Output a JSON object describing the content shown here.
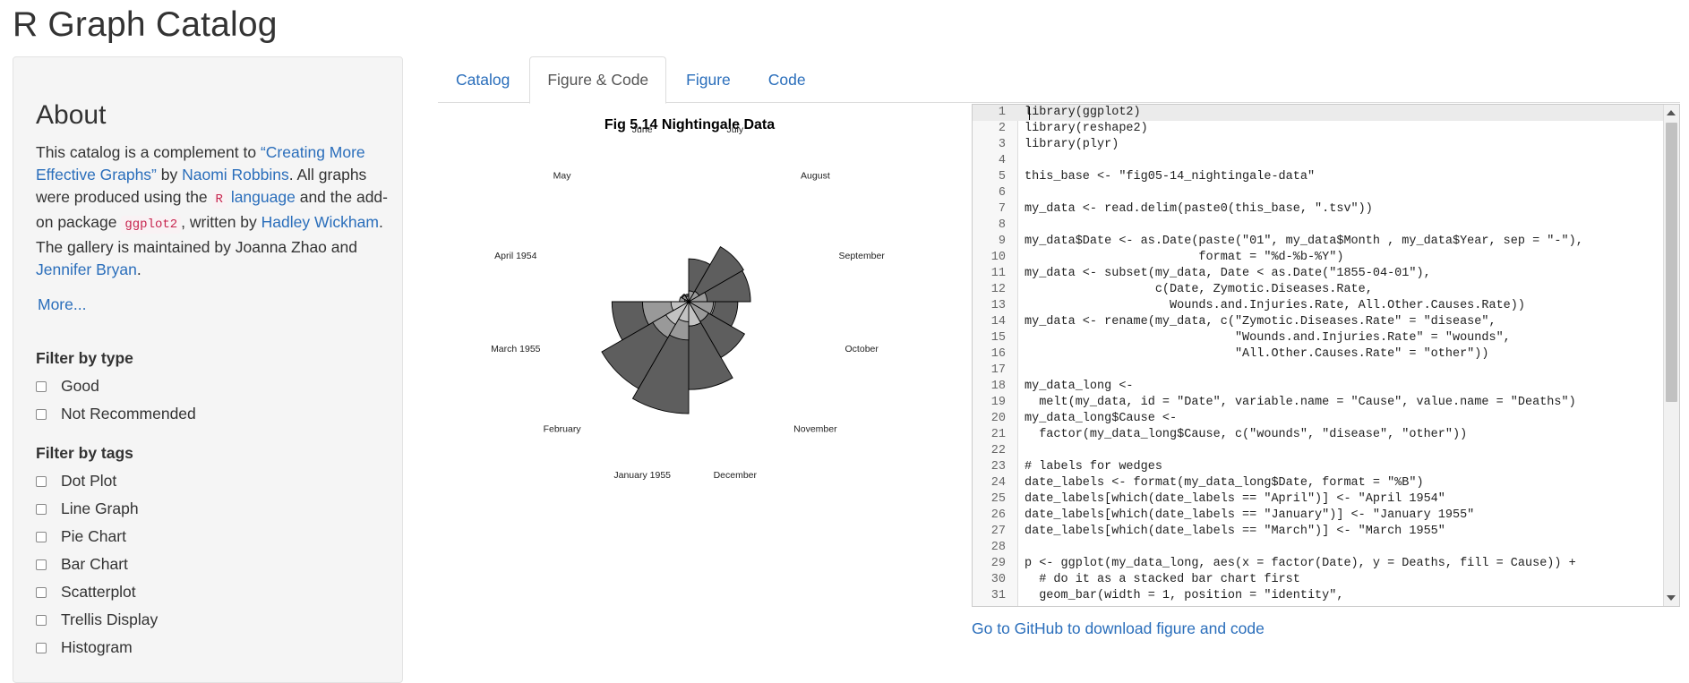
{
  "app": {
    "title": "R Graph Catalog"
  },
  "sidebar": {
    "about_title": "About",
    "about": {
      "t1": "This catalog is a complement to ",
      "link_book": "“Creating More Effective Graphs”",
      "t2": " by ",
      "link_author": "Naomi Robbins",
      "t3": ". All graphs were produced using the ",
      "code_r": "R",
      "link_language": "language",
      "t4": " and the add-on package ",
      "code_ggplot2": "ggplot2",
      "t5": ", written by ",
      "link_hadley": "Hadley Wickham",
      "t6": ". The gallery is maintained by Joanna Zhao and ",
      "link_jennifer": "Jennifer Bryan",
      "t7": "."
    },
    "more_label": "More...",
    "filter_type": {
      "heading": "Filter by type",
      "items": [
        {
          "label": "Good"
        },
        {
          "label": "Not Recommended"
        }
      ]
    },
    "filter_tags": {
      "heading": "Filter by tags",
      "items": [
        {
          "label": "Dot Plot"
        },
        {
          "label": "Line Graph"
        },
        {
          "label": "Pie Chart"
        },
        {
          "label": "Bar Chart"
        },
        {
          "label": "Scatterplot"
        },
        {
          "label": "Trellis Display"
        },
        {
          "label": "Histogram"
        }
      ]
    }
  },
  "tabs": [
    {
      "label": "Catalog",
      "active": false
    },
    {
      "label": "Figure & Code",
      "active": true
    },
    {
      "label": "Figure",
      "active": false
    },
    {
      "label": "Code",
      "active": false
    }
  ],
  "figure": {
    "title": "Fig 5.14 Nightingale Data",
    "months": [
      "April 1954",
      "May",
      "June",
      "July",
      "August",
      "September",
      "October",
      "November",
      "December",
      "January 1955",
      "February",
      "March 1955"
    ],
    "colors": {
      "disease": "#5e5e5e",
      "other": "#999999",
      "wounds": "#c2c2c2"
    },
    "wedges": [
      {
        "month": "April 1954",
        "disease": 1.4,
        "wounds": 0.0,
        "other": 7.0
      },
      {
        "month": "May",
        "disease": 6.2,
        "wounds": 0.0,
        "other": 4.6
      },
      {
        "month": "June",
        "disease": 4.7,
        "wounds": 0.0,
        "other": 2.5
      },
      {
        "month": "July",
        "disease": 150,
        "wounds": 0.0,
        "other": 9.6
      },
      {
        "month": "August",
        "disease": 328,
        "wounds": 0.0,
        "other": 11.9
      },
      {
        "month": "September",
        "disease": 312,
        "wounds": 0.0,
        "other": 27.7
      },
      {
        "month": "October",
        "disease": 197,
        "wounds": 56.1,
        "other": 50.1
      },
      {
        "month": "November",
        "disease": 340,
        "wounds": 43.0,
        "other": 42.8
      },
      {
        "month": "December",
        "disease": 631,
        "wounds": 48.0,
        "other": 48.0
      },
      {
        "month": "January 1955",
        "disease": 1022,
        "wounds": 32.8,
        "other": 120
      },
      {
        "month": "February",
        "disease": 822,
        "wounds": 56.6,
        "other": 141
      },
      {
        "month": "March 1955",
        "disease": 480,
        "wounds": 25.6,
        "other": 174
      }
    ]
  },
  "editor": {
    "lines": [
      "library(ggplot2)",
      "library(reshape2)",
      "library(plyr)",
      "",
      "this_base <- \"fig05-14_nightingale-data\"",
      "",
      "my_data <- read.delim(paste0(this_base, \".tsv\"))",
      "",
      "my_data$Date <- as.Date(paste(\"01\", my_data$Month , my_data$Year, sep = \"-\"),",
      "                        format = \"%d-%b-%Y\")",
      "my_data <- subset(my_data, Date < as.Date(\"1855-04-01\"),",
      "                  c(Date, Zymotic.Diseases.Rate,",
      "                    Wounds.and.Injuries.Rate, All.Other.Causes.Rate))",
      "my_data <- rename(my_data, c(\"Zymotic.Diseases.Rate\" = \"disease\",",
      "                             \"Wounds.and.Injuries.Rate\" = \"wounds\",",
      "                             \"All.Other.Causes.Rate\" = \"other\"))",
      "",
      "my_data_long <-",
      "  melt(my_data, id = \"Date\", variable.name = \"Cause\", value.name = \"Deaths\")",
      "my_data_long$Cause <-",
      "  factor(my_data_long$Cause, c(\"wounds\", \"disease\", \"other\"))",
      "",
      "# labels for wedges",
      "date_labels <- format(my_data_long$Date, format = \"%B\")",
      "date_labels[which(date_labels == \"April\")] <- \"April 1954\"",
      "date_labels[which(date_labels == \"January\")] <- \"January 1955\"",
      "date_labels[which(date_labels == \"March\")] <- \"March 1955\"",
      "",
      "p <- ggplot(my_data_long, aes(x = factor(Date), y = Deaths, fill = Cause)) +",
      "  # do it as a stacked bar chart first",
      "  geom_bar(width = 1, position = \"identity\","
    ]
  },
  "footer": {
    "github_label": "Go to GitHub to download figure and code"
  }
}
